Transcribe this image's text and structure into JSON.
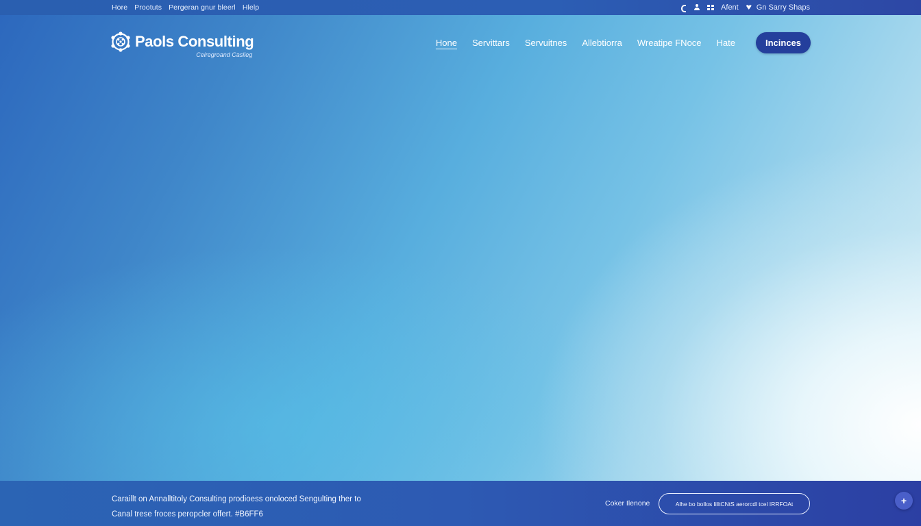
{
  "topbar": {
    "left_links": [
      "Hore",
      "Prootuts",
      "Pergeran gnur bleerl",
      "Hlelp"
    ],
    "right": {
      "phone_icon": "phone-icon",
      "user_icon": "user-icon",
      "grid_icon": "grid-icon",
      "account_label": "Afent",
      "heart_icon": "heart-icon",
      "shop_label": "Gn Sarry Shaps"
    }
  },
  "header": {
    "logo_name": "Paols Consulting",
    "logo_tagline": "Ceiregroand Caslieg",
    "nav": [
      {
        "label": "Hone",
        "active": true
      },
      {
        "label": "Servittars",
        "active": false
      },
      {
        "label": "Servuitnes",
        "active": false
      },
      {
        "label": "Allebtiorra",
        "active": false
      },
      {
        "label": "Wreatipe FNoce",
        "active": false
      },
      {
        "label": "Hate",
        "active": false
      }
    ],
    "cta_label": "Incinces"
  },
  "cookie": {
    "message_line1": "Caraillt on Annalltitoly Consulting prodioess onoloced Sengulting ther to",
    "message_line2": "Canal trese froces peropcler offert. #B6FF6",
    "link_label": "Coker Ilenone",
    "button_label": "Alhe bo bollos lilltCNtS aerorcdl tcel IRRFOAt",
    "fab_label": "+"
  },
  "colors": {
    "topbar": "#2c5eb4",
    "cta": "#243f9c",
    "cookie_bar": "#2d5ab3",
    "fab": "#4a5fc9"
  }
}
